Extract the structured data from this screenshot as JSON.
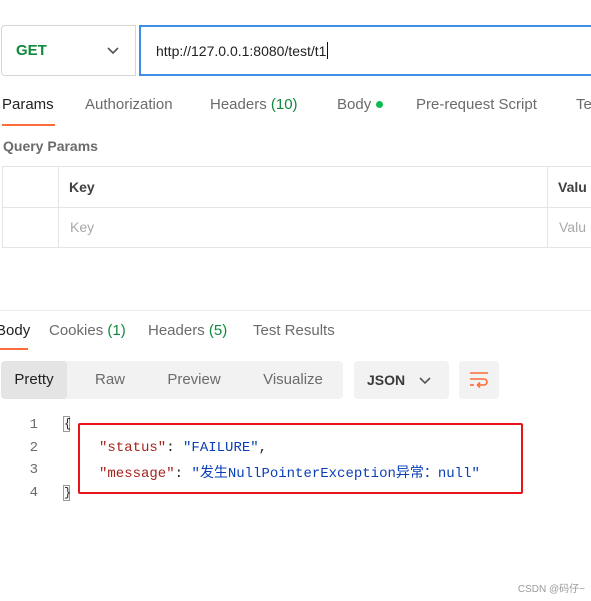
{
  "request": {
    "method": "GET",
    "url": "http://127.0.0.1:8080/test/t1"
  },
  "request_tabs": [
    {
      "label": "Params"
    },
    {
      "label": "Authorization"
    },
    {
      "label": "Headers",
      "count": "(10)"
    },
    {
      "label": "Body"
    },
    {
      "label": "Pre-request Script"
    },
    {
      "label": "Te"
    }
  ],
  "query_params": {
    "title": "Query Params",
    "col_key": "Key",
    "col_value": "Valu",
    "placeholder_key": "Key",
    "placeholder_value": "Valu"
  },
  "response_tabs": [
    {
      "label": "Body"
    },
    {
      "label": "Cookies",
      "count": "(1)"
    },
    {
      "label": "Headers",
      "count": "(5)"
    },
    {
      "label": "Test Results"
    }
  ],
  "view_modes": [
    "Pretty",
    "Raw",
    "Preview",
    "Visualize"
  ],
  "format": "JSON",
  "code": {
    "line_numbers": [
      "1",
      "2",
      "3",
      "4"
    ],
    "key1": "\"status\"",
    "val1": "\"FAILURE\"",
    "key2": "\"message\"",
    "val2": "\"发生NullPointerException异常：null\""
  },
  "watermark": "CSDN @码仔~",
  "colors": {
    "accent": "#ff6c37",
    "method_green": "#0f8a3c",
    "url_focus": "#3d8ee6",
    "highlight_box": "#e8141c"
  }
}
